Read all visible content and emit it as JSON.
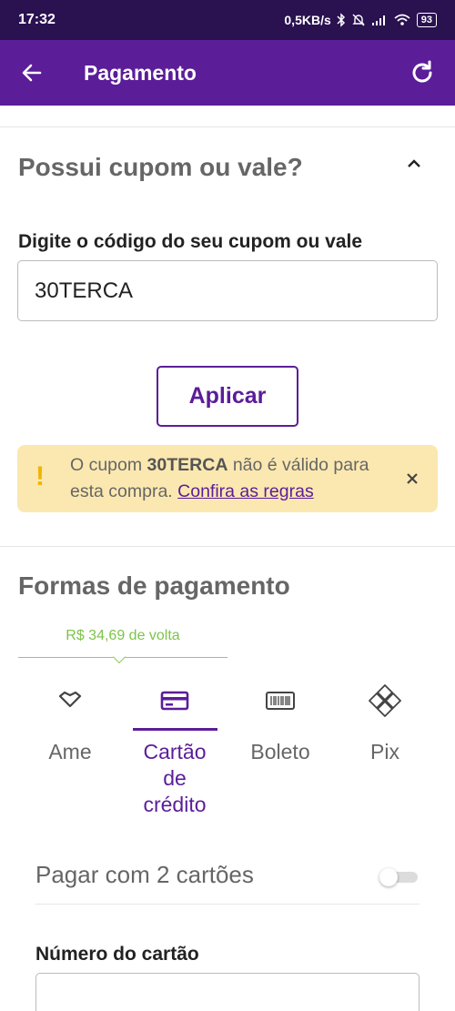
{
  "status_bar": {
    "time": "17:32",
    "network_speed": "0,5KB/s",
    "battery": "93",
    "icons": [
      "bluetooth-icon",
      "silent-icon",
      "signal-icon",
      "wifi-icon",
      "battery-icon"
    ]
  },
  "app_bar": {
    "title": "Pagamento",
    "back_icon": "arrow-left-icon",
    "refresh_icon": "refresh-icon"
  },
  "coupon": {
    "title": "Possui cupom ou vale?",
    "field_label": "Digite o código do seu cupom ou vale",
    "value": "30TERCA",
    "apply_label": "Aplicar",
    "alert": {
      "prefix": "O cupom ",
      "code": "30TERCA",
      "suffix": " não é válido para esta compra. ",
      "link": "Confira as regras"
    }
  },
  "payment": {
    "title": "Formas de pagamento",
    "cashback": "R$ 34,69 de volta",
    "tabs": [
      {
        "label": "Ame",
        "icon": "ame-heart-icon",
        "active": false
      },
      {
        "label": "Cartão de crédito",
        "icon": "credit-card-icon",
        "active": true
      },
      {
        "label": "Boleto",
        "icon": "barcode-icon",
        "active": false
      },
      {
        "label": "Pix",
        "icon": "pix-icon",
        "active": false
      }
    ],
    "two_cards_label": "Pagar com 2 cartões",
    "two_cards_enabled": false,
    "card_number_label": "Número do cartão",
    "card_number_value": ""
  },
  "colors": {
    "status_bar": "#2a1150",
    "brand_purple": "#5b1d98",
    "alert_bg": "#fbe8b0",
    "alert_icon": "#f0b400",
    "cashback_green": "#7cc44a"
  }
}
